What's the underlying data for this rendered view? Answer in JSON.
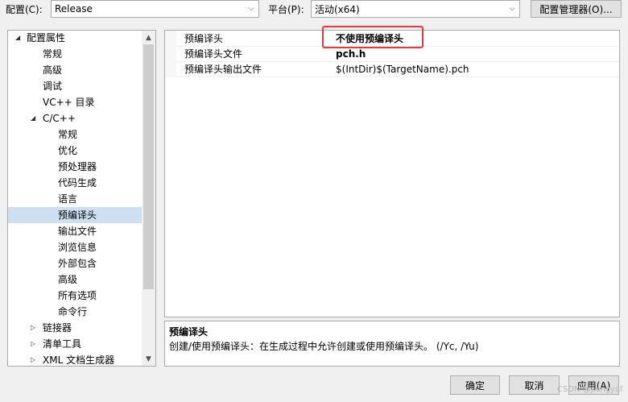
{
  "toolbar": {
    "config_label": "配置(C):",
    "config_value": "Release",
    "platform_label": "平台(P):",
    "platform_value": "活动(x64)",
    "config_manager_button": "配置管理器(O)..."
  },
  "tree": {
    "items": [
      {
        "label": "配置属性",
        "twisty": "◢"
      },
      {
        "label": "常规"
      },
      {
        "label": "高级"
      },
      {
        "label": "调试"
      },
      {
        "label": "VC++ 目录"
      },
      {
        "label": "C/C++",
        "twisty": "◢"
      },
      {
        "label": "常规"
      },
      {
        "label": "优化"
      },
      {
        "label": "预处理器"
      },
      {
        "label": "代码生成"
      },
      {
        "label": "语言"
      },
      {
        "label": "预编译头",
        "selected": true
      },
      {
        "label": "输出文件"
      },
      {
        "label": "浏览信息"
      },
      {
        "label": "外部包含"
      },
      {
        "label": "高级"
      },
      {
        "label": "所有选项"
      },
      {
        "label": "命令行"
      },
      {
        "label": "链接器",
        "twisty": "▷"
      },
      {
        "label": "清单工具",
        "twisty": "▷"
      },
      {
        "label": "XML 文档生成器",
        "twisty": "▷"
      }
    ],
    "scroll_up": "▲",
    "scroll_down": "▼"
  },
  "properties": [
    {
      "name": "预编译头",
      "value": "不使用预编译头",
      "bold": true
    },
    {
      "name": "预编译头文件",
      "value": "pch.h",
      "bold": true
    },
    {
      "name": "预编译头输出文件",
      "value": "$(IntDir)$(TargetName).pch",
      "bold": false
    }
  ],
  "description": {
    "title": "预编译头",
    "text": "创建/使用预编译头：在生成过程中允许创建或使用预编译头。     (/Yc, /Yu)"
  },
  "buttons": {
    "ok": "确定",
    "cancel": "取消",
    "apply": "应用(A)"
  },
  "watermark": "CSDN @jiangyaf",
  "icons": {
    "dropdown": "chevron-down-icon",
    "expanded": "triangle-expanded-icon",
    "collapsed": "triangle-collapsed-icon"
  },
  "colors": {
    "selected_row": "#cde0f2",
    "highlight_box": "#e8383d"
  }
}
